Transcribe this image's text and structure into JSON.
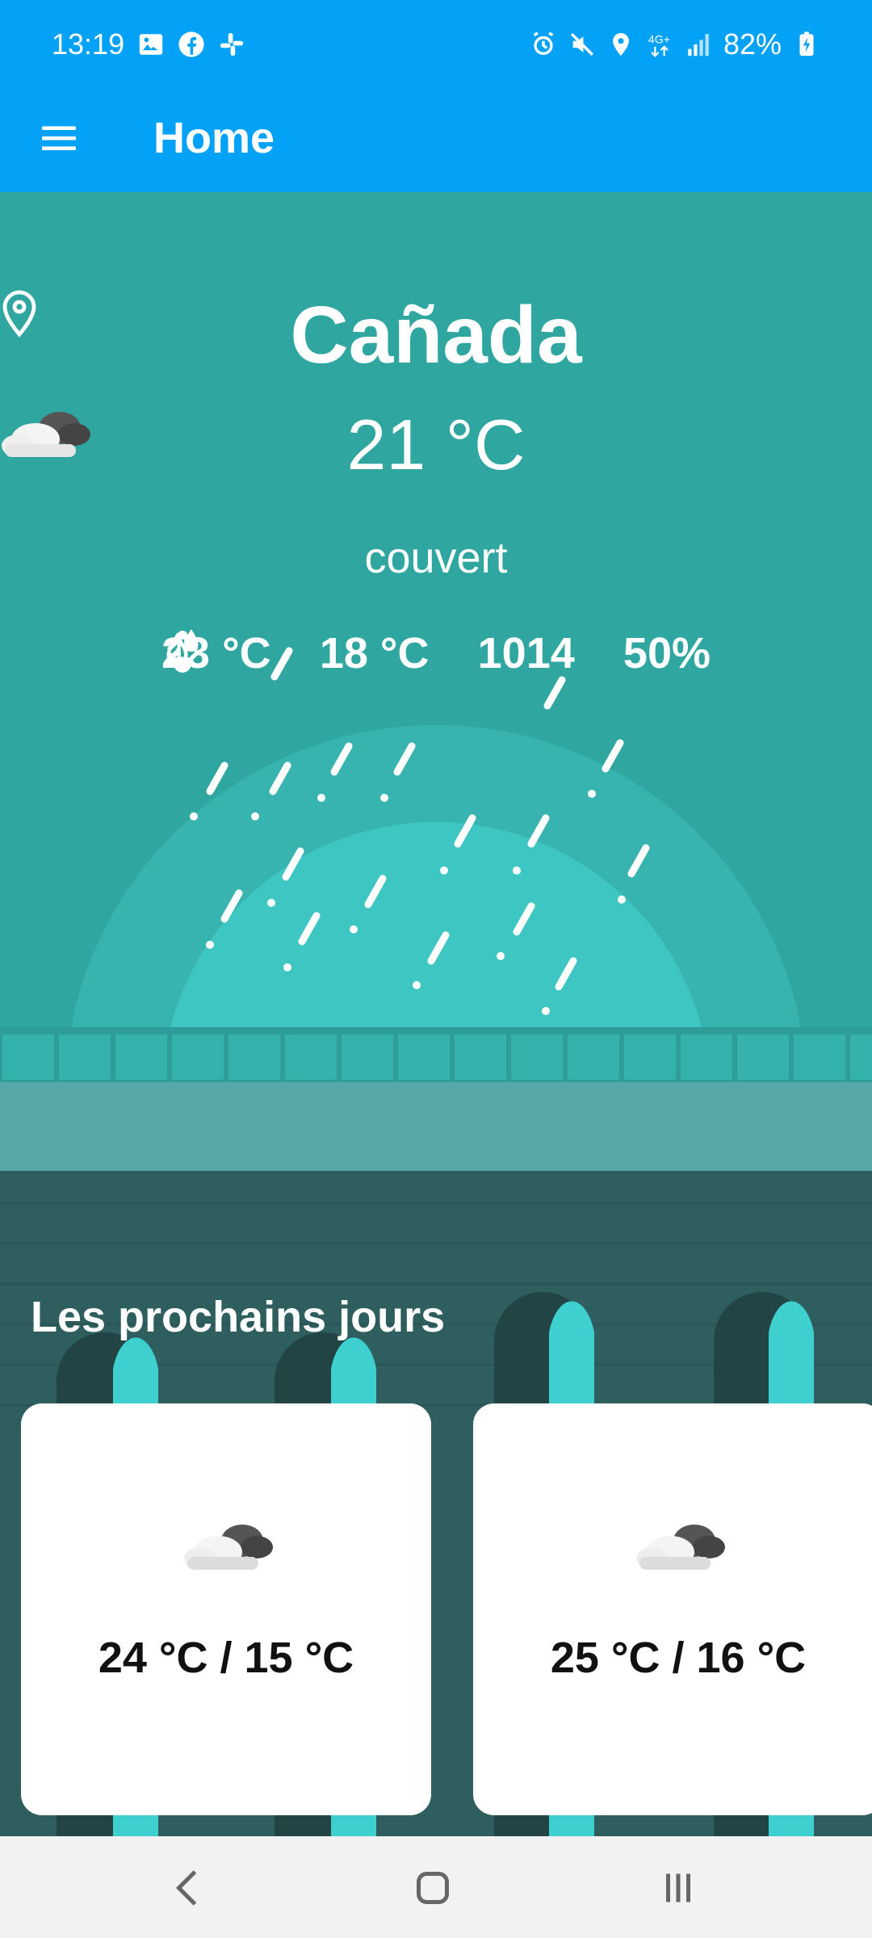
{
  "status_bar": {
    "time": "13:19",
    "left_icons": [
      "gallery-icon",
      "facebook-icon",
      "slack-icon"
    ],
    "right_icons": [
      "alarm-icon",
      "mute-icon",
      "location-icon",
      "4g-icon",
      "signal-icon"
    ],
    "battery": "82%"
  },
  "app_bar": {
    "title": "Home"
  },
  "weather": {
    "city": "Cañada",
    "temperature": "21 °C",
    "condition": "couvert",
    "stats": [
      {
        "icon": "arrow-up-icon",
        "value": "23 °C"
      },
      {
        "icon": "arrow-down-icon",
        "value": "18 °C"
      },
      {
        "icon": "thermometer-icon",
        "value": "1014"
      },
      {
        "icon": "humidity-icon",
        "value": "50%"
      }
    ]
  },
  "forecast": {
    "title": "Les prochains jours",
    "days": [
      {
        "icon": "cloud-icon",
        "range": "24 °C / 15 °C"
      },
      {
        "icon": "cloud-icon",
        "range": "25 °C / 16 °C"
      }
    ]
  },
  "nav": {
    "buttons": [
      "back-button",
      "home-button",
      "recents-button"
    ]
  },
  "colors": {
    "app_bar": "#03A2F7",
    "scene": "#2FA6A0",
    "ground": "#2E5E5E"
  }
}
